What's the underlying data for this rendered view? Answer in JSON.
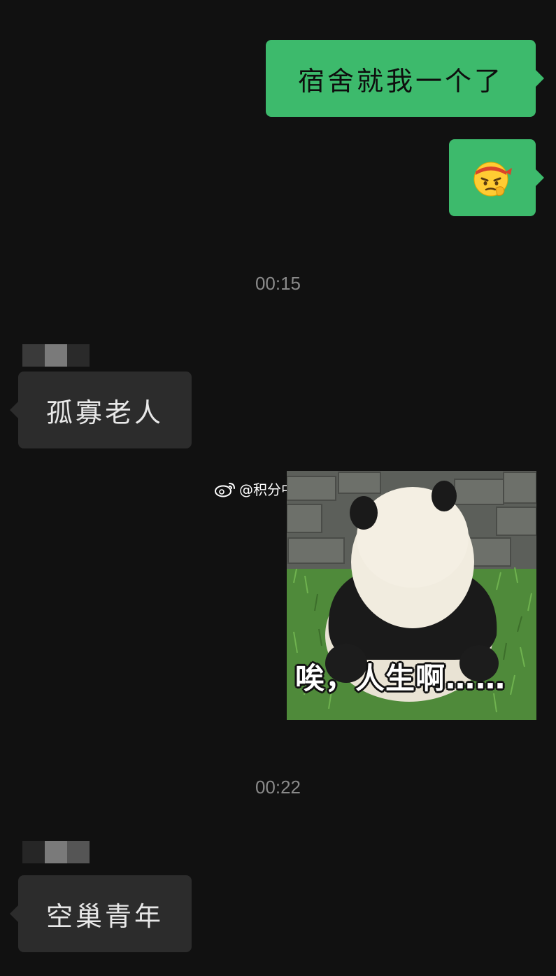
{
  "messages": {
    "sent_1": "宿舍就我一个了",
    "sent_2_emoji": "thinking-headband-emoji",
    "recv_1": "孤寡老人",
    "recv_2": "空巢青年"
  },
  "timestamps": {
    "t1": "00:15",
    "t2": "00:22"
  },
  "image_message": {
    "subject": "panda-back-photo",
    "caption": "唉，人生啊……"
  },
  "watermark": {
    "text": "@积分中中定理",
    "icon": "weibo-icon"
  },
  "colors": {
    "background": "#111111",
    "sent_bubble": "#3dba6c",
    "received_bubble": "#2c2c2c",
    "timestamp": "#8a8a8a"
  }
}
